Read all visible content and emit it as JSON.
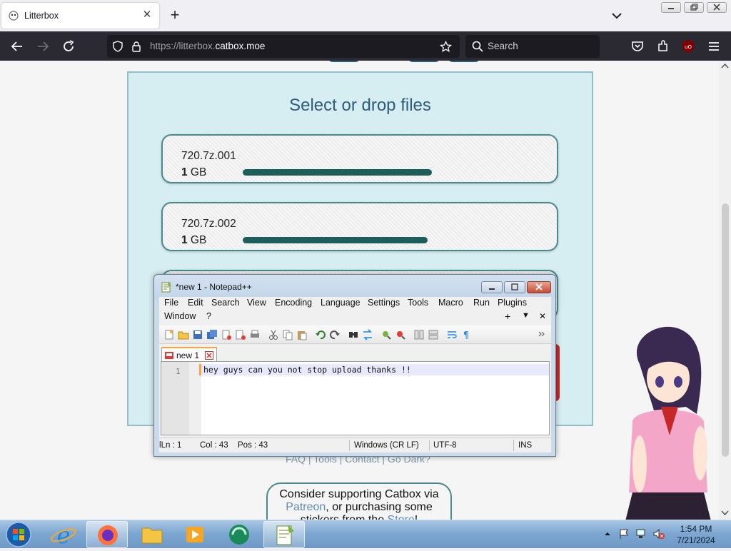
{
  "browser": {
    "tab": {
      "title": "Litterbox",
      "close": "✕"
    },
    "new_tab": "+",
    "url": {
      "prefix": "https://litterbox.",
      "host": "catbox.moe"
    },
    "search_placeholder": "Search"
  },
  "page": {
    "upload_title": "Select or drop files",
    "files": [
      {
        "name": "720.7z.001",
        "size_num": "1",
        "size_unit": " GB",
        "progress": 0.48
      },
      {
        "name": "720.7z.002",
        "size_num": "1",
        "size_unit": " GB",
        "progress": 0.47
      }
    ],
    "footer_links": "FAQ | Tools | Contact | Go Dark?",
    "support": {
      "line1": "Consider supporting Catbox via",
      "patreon": "Patreon",
      "line2": ", or purchasing some",
      "line3a": "stickers from the ",
      "store": "Store",
      "line3b": "!"
    }
  },
  "notepad": {
    "title": "*new 1 - Notepad++",
    "menu": [
      "File",
      "Edit",
      "Search",
      "View",
      "Encoding",
      "Language",
      "Settings",
      "Tools",
      "Macro",
      "Run",
      "Plugins",
      "Window",
      "?"
    ],
    "menu_extra": {
      "plus": "+",
      "down": "▼",
      "close": "✕"
    },
    "tab_label": "new 1",
    "line_number": "1",
    "text": "hey guys can you not stop upload thanks !!",
    "status": {
      "ln": "Ln : 1",
      "col": "Col : 43",
      "pos": "Pos : 43",
      "eol": "Windows (CR LF)",
      "encoding": "UTF-8",
      "mode": "INS"
    }
  },
  "taskbar": {
    "clock_time": "1:54 PM",
    "clock_date": "7/21/2024"
  },
  "colors": {
    "panel_bg": "#d6eef2",
    "progress": "#1e5e5a",
    "firefox_toolbar": "#2b2a33"
  }
}
